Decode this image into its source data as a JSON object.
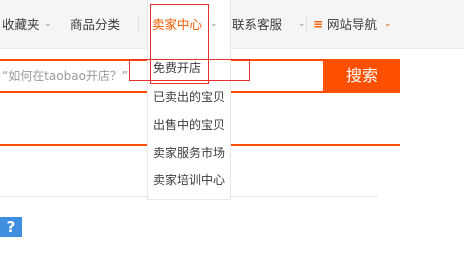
{
  "topnav": {
    "favorites": "收藏夹",
    "categories": "商品分类",
    "seller_center": "卖家中心",
    "customer_service": "联系客服",
    "site_nav": "网站导航",
    "site_nav_icon": "≡",
    "arrow": "⌄"
  },
  "seller_menu": {
    "items": [
      "免费开店",
      "已卖出的宝贝",
      "出售中的宝贝",
      "卖家服务市场",
      "卖家培训中心"
    ]
  },
  "search": {
    "placeholder": "“如何在taobao开店？”",
    "button_label": "搜索"
  },
  "help": {
    "icon_text": "?"
  },
  "colors": {
    "accent": "#ff5000",
    "annotation": "#e83030",
    "help_blue": "#3f8ee0"
  }
}
